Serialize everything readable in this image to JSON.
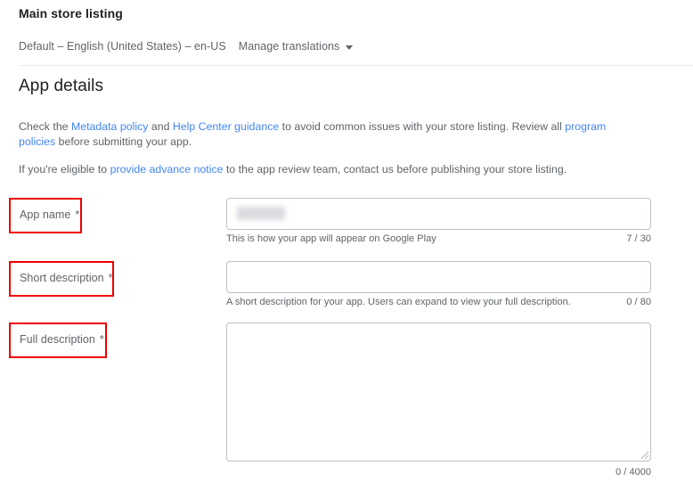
{
  "header": {
    "title": "Main store listing",
    "language_label": "Default – English (United States) – en-US",
    "manage_translations_label": "Manage translations",
    "caret_icon": "chevron-down-icon"
  },
  "section": {
    "title": "App details",
    "intro_part1": "Check the ",
    "intro_link_metadata": "Metadata policy",
    "intro_part2": " and ",
    "intro_link_help": "Help Center guidance",
    "intro_part3": " to avoid common issues with your store listing. Review all ",
    "intro_link_program": "program policies",
    "intro_part4": " before submitting your app.",
    "intro2_part1": "If you're eligible to ",
    "intro2_link_notice": "provide advance notice",
    "intro2_part2": " to the app review team, contact us before publishing your store listing."
  },
  "fields": {
    "app_name": {
      "label": "App name",
      "required_marker": "*",
      "value": "",
      "value_redacted": true,
      "helper": "This is how your app will appear on Google Play",
      "counter": "7 / 30"
    },
    "short_description": {
      "label": "Short description",
      "required_marker": "*",
      "value": "",
      "helper": "A short description for your app. Users can expand to view your full description.",
      "counter": "0 / 80"
    },
    "full_description": {
      "label": "Full description",
      "required_marker": "*",
      "value": "",
      "helper": "",
      "counter": "0 / 4000"
    }
  },
  "colors": {
    "annotation": "#ee0000",
    "link": "#4285f4",
    "text": "#5f6368",
    "heading": "#202124",
    "border": "#bdc1c6"
  }
}
